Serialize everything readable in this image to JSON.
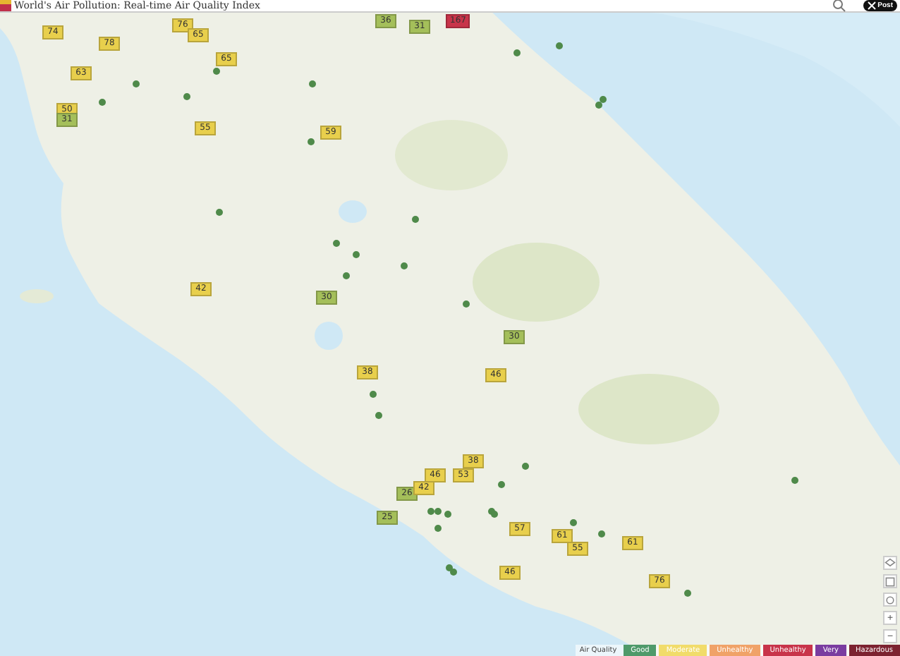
{
  "header": {
    "title": "World's Air Pollution: Real-time Air Quality Index",
    "post_button": "Post"
  },
  "markers": [
    {
      "value": "74",
      "color": "#e8cf4c"
    },
    {
      "value": "78",
      "color": "#e8cf4c"
    },
    {
      "value": "76",
      "color": "#e8cf4c"
    },
    {
      "value": "65",
      "color": "#e8cf4c"
    },
    {
      "value": "36",
      "color": "#a4bf5a"
    },
    {
      "value": "31",
      "color": "#a4bf5a"
    },
    {
      "value": "167",
      "color": "#c8344a"
    },
    {
      "value": "65",
      "color": "#e8cf4c"
    },
    {
      "value": "63",
      "color": "#e8cf4c"
    },
    {
      "value": "50",
      "color": "#e8cf4c"
    },
    {
      "value": "31",
      "color": "#a4bf5a"
    },
    {
      "value": "55",
      "color": "#e8cf4c"
    },
    {
      "value": "59",
      "color": "#e8cf4c"
    },
    {
      "value": "42",
      "color": "#e8cf4c"
    },
    {
      "value": "30",
      "color": "#a4bf5a"
    },
    {
      "value": "30",
      "color": "#a4bf5a"
    },
    {
      "value": "46",
      "color": "#e8cf4c"
    },
    {
      "value": "38",
      "color": "#e8cf4c"
    },
    {
      "value": "26",
      "color": "#a4bf5a"
    },
    {
      "value": "25",
      "color": "#a4bf5a"
    },
    {
      "value": "42",
      "color": "#e8cf4c"
    },
    {
      "value": "46",
      "color": "#e8cf4c"
    },
    {
      "value": "53",
      "color": "#e8cf4c"
    },
    {
      "value": "38",
      "color": "#e8cf4c"
    },
    {
      "value": "57",
      "color": "#e8cf4c"
    },
    {
      "value": "61",
      "color": "#e8cf4c"
    },
    {
      "value": "55",
      "color": "#e8cf4c"
    },
    {
      "value": "61",
      "color": "#e8cf4c"
    },
    {
      "value": "46",
      "color": "#e8cf4c"
    },
    {
      "value": "76",
      "color": "#e8cf4c"
    }
  ],
  "zoom_controls": [
    "+",
    "−"
  ],
  "legend": {
    "title": "Air Quality",
    "items": [
      {
        "label": "Good",
        "color": "#4f9a6a"
      },
      {
        "label": "Moderate",
        "color": "#f1dc6a"
      },
      {
        "label": "Unhealthy",
        "color": "#f0a268"
      },
      {
        "label": "Unhealthy",
        "color": "#c8344a"
      },
      {
        "label": "Very",
        "color": "#7a3ca0"
      },
      {
        "label": "Hazardous",
        "color": "#7c2230"
      }
    ]
  }
}
